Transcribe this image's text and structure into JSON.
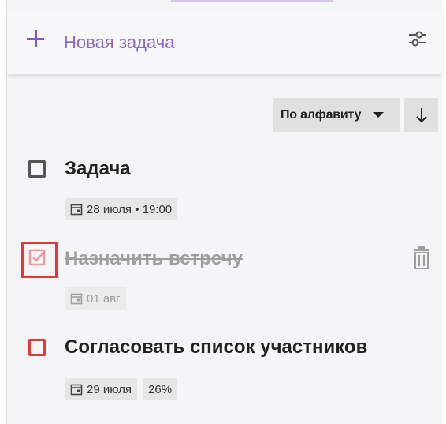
{
  "new_task": {
    "label": "Новая задача"
  },
  "sort": {
    "label": "По алфавиту"
  },
  "tasks": [
    {
      "title": "Задача",
      "chips": [
        "28 июля • 19:00"
      ],
      "done": false
    },
    {
      "title": "Назначить встречу",
      "chips": [
        "01 авг"
      ],
      "done": true
    },
    {
      "title": "Согласовать список участников",
      "chips": [
        "29 июля",
        "26%"
      ],
      "done": false
    }
  ],
  "colors": {
    "accent": "#7e57c2",
    "danger": "#e53935",
    "text": "#222222",
    "muted": "#9e9e9e"
  }
}
